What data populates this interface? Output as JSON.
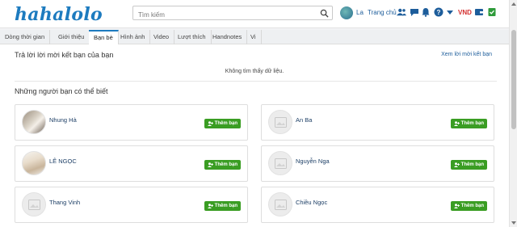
{
  "header": {
    "logo": "hahalolo",
    "search_placeholder": "Tìm kiếm",
    "user_name": "La",
    "home_label": "Trang chủ",
    "currency": "VND"
  },
  "tabs": [
    {
      "label": "Dòng thời gian",
      "active": false
    },
    {
      "label": "Giới thiệu",
      "active": false
    },
    {
      "label": "Bạn bè",
      "active": true
    },
    {
      "label": "Hình ảnh",
      "active": false
    },
    {
      "label": "Video",
      "active": false
    },
    {
      "label": "Lượt thích",
      "active": false
    },
    {
      "label": "Handnotes",
      "active": false
    },
    {
      "label": "Vi",
      "active": false
    }
  ],
  "requests": {
    "title": "Trả lời lời mời kết bạn của bạn",
    "see_all": "Xem lời mời kết bạn",
    "empty": "Không tìm thấy dữ liệu."
  },
  "suggestions": {
    "title": "Những người bạn có thể biết",
    "add_label": "Thêm bạn",
    "people": [
      {
        "name": "Nhung Hà",
        "photo": true
      },
      {
        "name": "An Ba",
        "photo": false
      },
      {
        "name": "LÊ NGỌC",
        "photo": true
      },
      {
        "name": "Nguyễn Nga",
        "photo": false
      },
      {
        "name": "Thang Vinh",
        "photo": false
      },
      {
        "name": "Chiều Ngọc",
        "photo": false
      }
    ]
  },
  "colors": {
    "brand": "#1d7bbf",
    "add_button": "#3a9d23",
    "currency": "#d32f2f"
  }
}
